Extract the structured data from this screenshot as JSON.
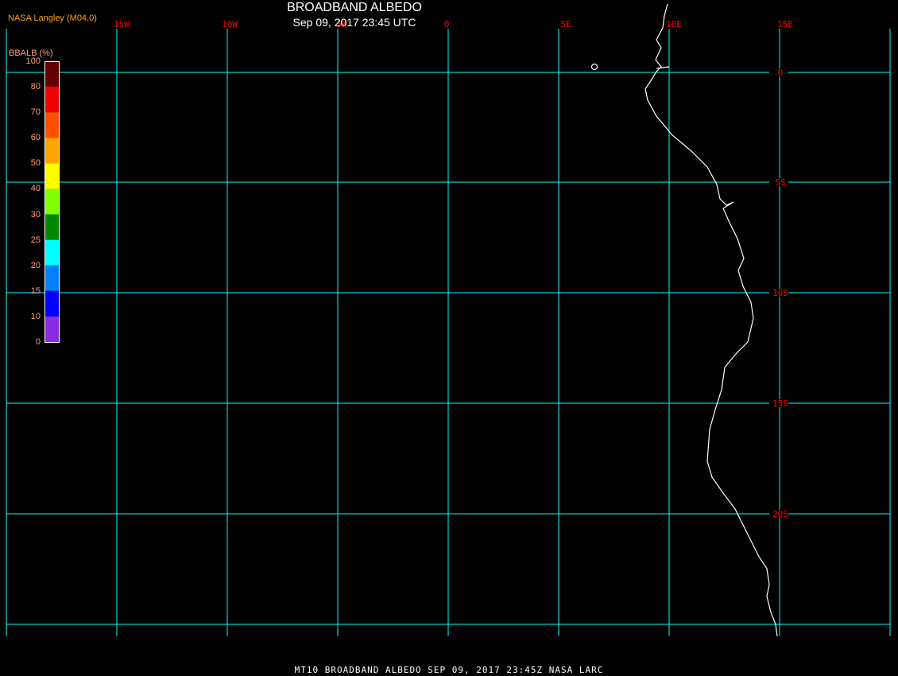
{
  "header": {
    "title": "BROADBAND ALBEDO",
    "subtitle": "Sep 09, 2017 23:45 UTC",
    "credit": "NASA Langley (M04.0)"
  },
  "map": {
    "grid_color": "#00ffff",
    "label_color": "#ff0000",
    "coast_color": "#ffffff",
    "lon_labels": [
      "15W",
      "10W",
      "5W",
      "0",
      "5E",
      "10E",
      "15E"
    ],
    "lat_labels": [
      "0",
      "5S",
      "10S",
      "15S",
      "20S"
    ]
  },
  "colorbar": {
    "title": "BBALB (%)",
    "labels": [
      "100",
      "80",
      "70",
      "60",
      "50",
      "40",
      "30",
      "25",
      "20",
      "15",
      "10",
      "0"
    ],
    "colors": [
      "#600000",
      "#f00000",
      "#ff5000",
      "#ffa500",
      "#ffff00",
      "#80ff00",
      "#008800",
      "#00ffff",
      "#0080ff",
      "#0000ff",
      "#8a2be2"
    ]
  },
  "footer": "MT10  BROADBAND ALBEDO   SEP 09, 2017 23:45Z   NASA LARC"
}
